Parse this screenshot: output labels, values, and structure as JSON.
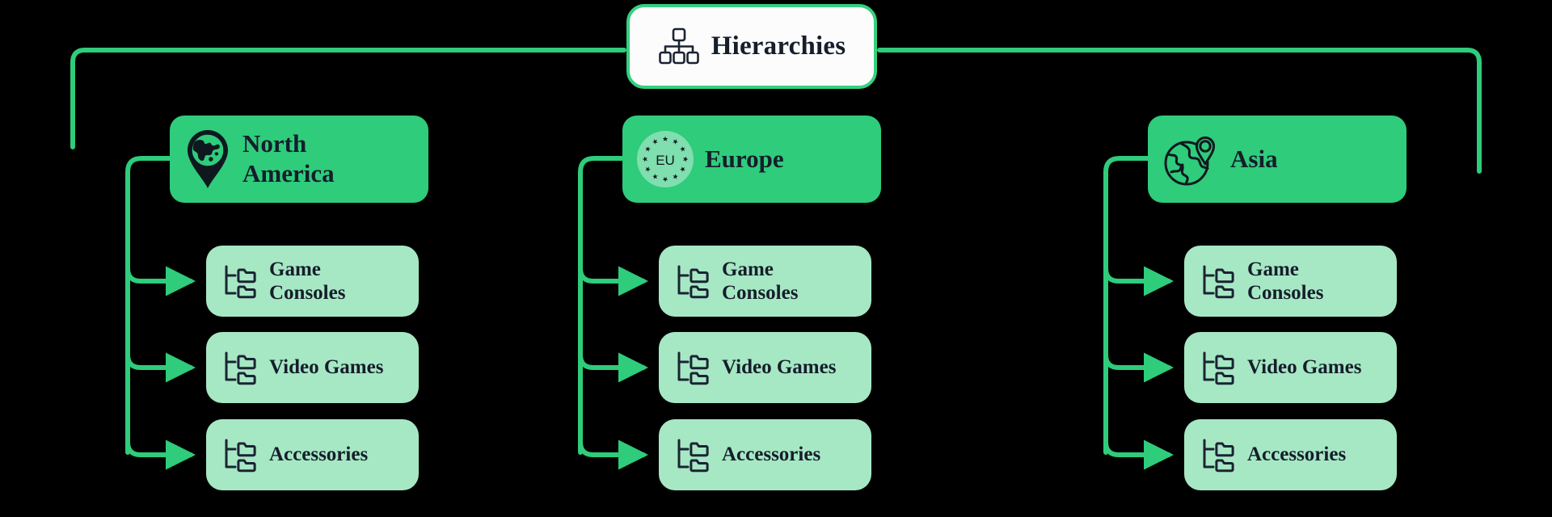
{
  "diagram": {
    "title": "Hierarchies",
    "background_color": "#000000",
    "root": {
      "label": "Hierarchies",
      "icon": "org-chart-icon",
      "fill_color": "#fcfcfc",
      "border_color": "#35d07f",
      "text_color": "#161d2b"
    },
    "colors": {
      "region_fill": "#2ecc7b",
      "leaf_fill": "#a6e8c4",
      "connector": "#2ecc7b",
      "text": "#161d2b"
    },
    "child_labels": {
      "game_consoles": "Game\nConsoles",
      "video_games": "Video Games",
      "accessories": "Accessories"
    },
    "regions": [
      {
        "id": "north-america",
        "label": "North\nAmerica",
        "icon": "globe-pin-americas-icon",
        "children": [
          {
            "id": "game-consoles",
            "label": "Game\nConsoles",
            "icon": "folder-tree-icon"
          },
          {
            "id": "video-games",
            "label": "Video Games",
            "icon": "folder-tree-icon"
          },
          {
            "id": "accessories",
            "label": "Accessories",
            "icon": "folder-tree-icon"
          }
        ]
      },
      {
        "id": "europe",
        "label": "Europe",
        "icon": "eu-stars-icon",
        "icon_text": "EU",
        "children": [
          {
            "id": "game-consoles",
            "label": "Game\nConsoles",
            "icon": "folder-tree-icon"
          },
          {
            "id": "video-games",
            "label": "Video Games",
            "icon": "folder-tree-icon"
          },
          {
            "id": "accessories",
            "label": "Accessories",
            "icon": "folder-tree-icon"
          }
        ]
      },
      {
        "id": "asia",
        "label": "Asia",
        "icon": "globe-with-pin-icon",
        "children": [
          {
            "id": "game-consoles",
            "label": "Game\nConsoles",
            "icon": "folder-tree-icon"
          },
          {
            "id": "video-games",
            "label": "Video Games",
            "icon": "folder-tree-icon"
          },
          {
            "id": "accessories",
            "label": "Accessories",
            "icon": "folder-tree-icon"
          }
        ]
      }
    ]
  }
}
